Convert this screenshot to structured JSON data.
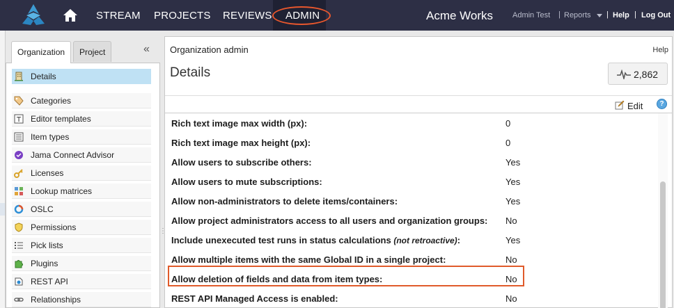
{
  "nav": {
    "items": [
      "STREAM",
      "PROJECTS",
      "REVIEWS",
      "ADMIN"
    ],
    "brand": "Acme Works",
    "user": "Admin Test",
    "reports": "Reports",
    "sep": "|",
    "help": "Help",
    "logout": "Log Out"
  },
  "left": {
    "tabs": [
      "Organization",
      "Project"
    ],
    "collapse_glyph": "«",
    "items": [
      {
        "label": "Details",
        "icon": "building-icon"
      },
      {
        "label": "Categories",
        "icon": "tag-icon"
      },
      {
        "label": "Editor templates",
        "icon": "template-icon"
      },
      {
        "label": "Item types",
        "icon": "item-types-icon"
      },
      {
        "label": "Jama Connect Advisor",
        "icon": "advisor-icon"
      },
      {
        "label": "Licenses",
        "icon": "key-icon"
      },
      {
        "label": "Lookup matrices",
        "icon": "matrix-icon"
      },
      {
        "label": "OSLC",
        "icon": "oslc-icon"
      },
      {
        "label": "Permissions",
        "icon": "shield-icon"
      },
      {
        "label": "Pick lists",
        "icon": "list-icon"
      },
      {
        "label": "Plugins",
        "icon": "puzzle-icon"
      },
      {
        "label": "REST API",
        "icon": "api-icon"
      },
      {
        "label": "Relationships",
        "icon": "link-icon"
      }
    ]
  },
  "right": {
    "org_title": "Organization admin",
    "help": "Help",
    "title": "Details",
    "count": "2,862",
    "edit": "Edit",
    "info": "?",
    "rows": [
      {
        "key": "Rich text image max width (px):",
        "value": "0"
      },
      {
        "key": "Rich text image max height (px):",
        "value": "0"
      },
      {
        "key": "Allow users to subscribe others:",
        "value": "Yes"
      },
      {
        "key": "Allow users to mute subscriptions:",
        "value": "Yes"
      },
      {
        "key": "Allow non-administrators to delete items/containers:",
        "value": "Yes"
      },
      {
        "key": "Allow project administrators access to all users and organization groups:",
        "value": "No"
      },
      {
        "key": "Include unexecuted test runs in status calculations",
        "note": "(not retroactive)",
        "suffix": ":",
        "value": "Yes"
      },
      {
        "key": "Allow multiple items with the same Global ID in a single project:",
        "value": "No"
      },
      {
        "key": "Allow deletion of fields and data from item types:",
        "value": "No"
      },
      {
        "key": "REST API Managed Access is enabled:",
        "value": "No"
      }
    ]
  },
  "colors": {
    "topbar": "#2d2f45",
    "highlight": "#e05a2a",
    "selected": "#bfe1f4"
  }
}
